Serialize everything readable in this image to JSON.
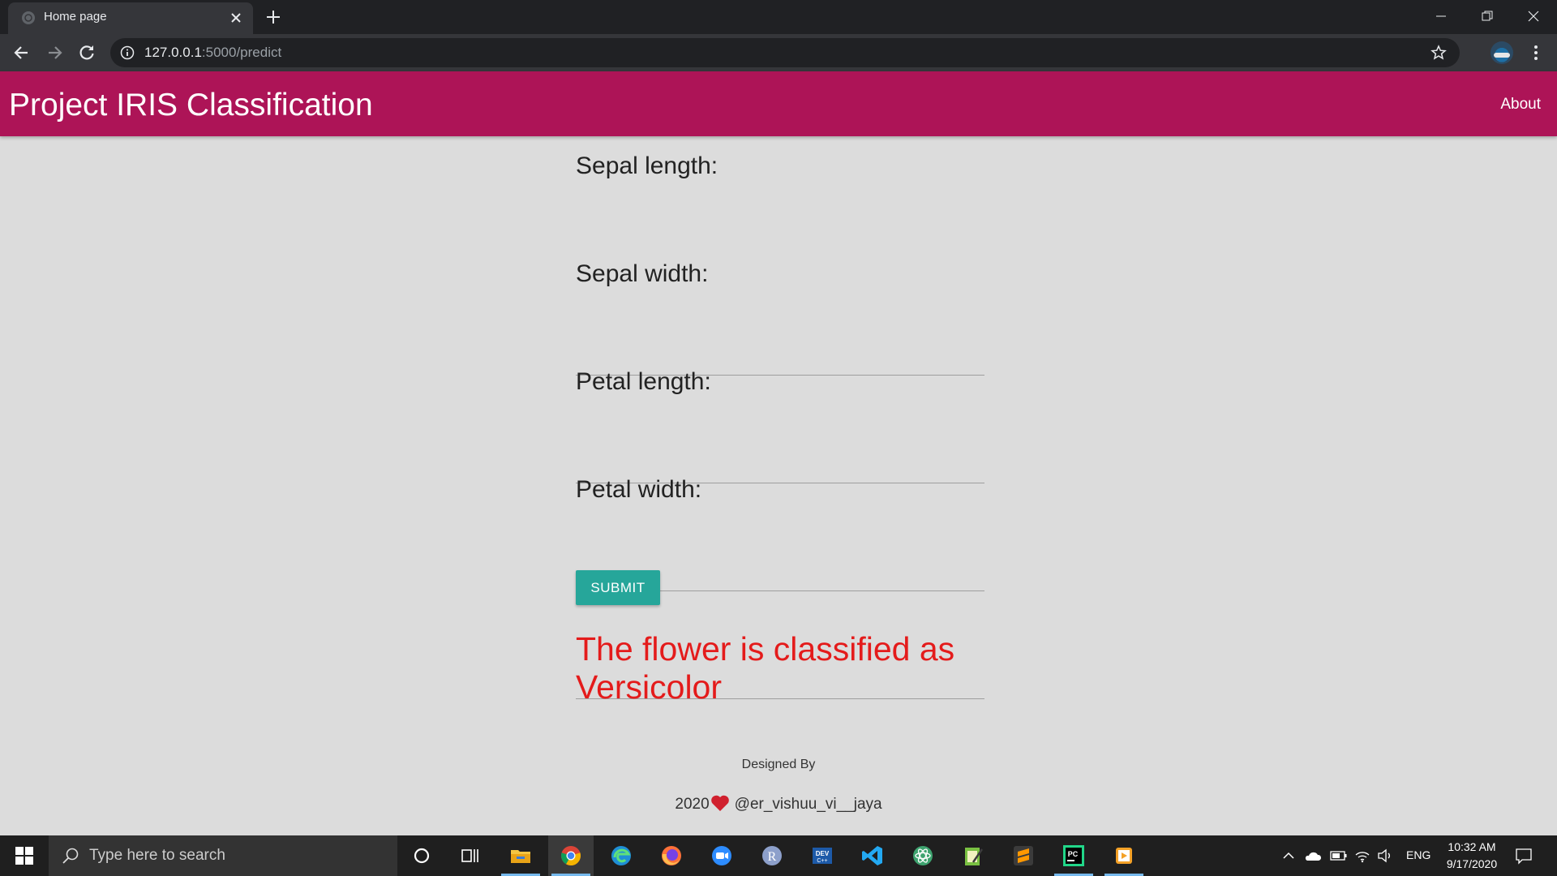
{
  "browser": {
    "tab_title": "Home page",
    "url_host": "127.0.0.1",
    "url_rest": ":5000/predict"
  },
  "app": {
    "brand": "Project IRIS Classification",
    "nav": {
      "about": "About"
    },
    "colors": {
      "header": "#ad1457",
      "button": "#26a69a",
      "result": "#e41b1b"
    }
  },
  "form": {
    "fields": [
      {
        "label": "Sepal length:",
        "value": ""
      },
      {
        "label": "Sepal width:",
        "value": ""
      },
      {
        "label": "Petal length:",
        "value": ""
      },
      {
        "label": "Petal width:",
        "value": ""
      }
    ],
    "submit_label": "SUBMIT"
  },
  "result": {
    "line1": "The flower is classified as",
    "line2": "Versicolor"
  },
  "footer": {
    "designed_by": "Designed By",
    "year": "2020",
    "handle": "@er_vishuu_vi__jaya"
  },
  "taskbar": {
    "search_placeholder": "Type here to search",
    "pinned_apps": [
      "cortana-icon",
      "task-view-icon",
      "file-explorer-icon",
      "chrome-icon",
      "edge-icon",
      "firefox-icon",
      "zoom-icon",
      "r-icon",
      "devc-icon",
      "vscode-icon",
      "atom-icon",
      "notepad-icon",
      "sublime-icon",
      "pycharm-icon",
      "media-player-icon"
    ],
    "language": "ENG",
    "time": "10:32 AM",
    "date": "9/17/2020"
  }
}
